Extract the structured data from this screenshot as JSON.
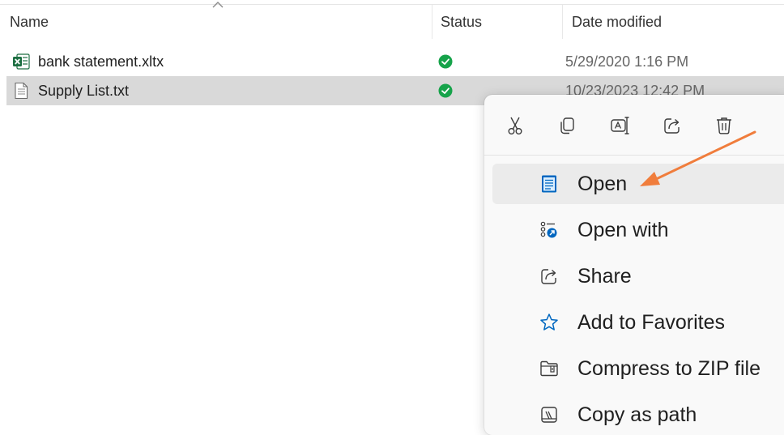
{
  "columns": {
    "name": "Name",
    "status": "Status",
    "date_modified": "Date modified"
  },
  "files": [
    {
      "name": "bank statement.xltx",
      "icon": "excel-template-icon",
      "status": "synced",
      "date": "5/29/2020 1:16 PM",
      "selected": false
    },
    {
      "name": "Supply List.txt",
      "icon": "text-file-icon",
      "status": "synced",
      "date": "10/23/2023 12:42 PM",
      "selected": true
    }
  ],
  "context_menu": {
    "quick_actions": [
      {
        "name": "cut",
        "icon": "scissors-icon"
      },
      {
        "name": "copy",
        "icon": "copy-icon"
      },
      {
        "name": "rename",
        "icon": "rename-icon"
      },
      {
        "name": "share",
        "icon": "share-icon"
      },
      {
        "name": "delete",
        "icon": "trash-icon"
      }
    ],
    "items": [
      {
        "label": "Open",
        "icon": "notepad-icon",
        "highlighted": true
      },
      {
        "label": "Open with",
        "icon": "open-with-icon"
      },
      {
        "label": "Share",
        "icon": "share-icon"
      },
      {
        "label": "Add to Favorites",
        "icon": "star-icon"
      },
      {
        "label": "Compress to ZIP file",
        "icon": "zip-folder-icon"
      },
      {
        "label": "Copy as path",
        "icon": "copy-path-icon"
      }
    ]
  },
  "colors": {
    "selection": "#d9d9d9",
    "status_ok": "#16a34a",
    "excel": "#1d6f42",
    "accent": "#0067c0",
    "arrow": "#f07d3c"
  }
}
